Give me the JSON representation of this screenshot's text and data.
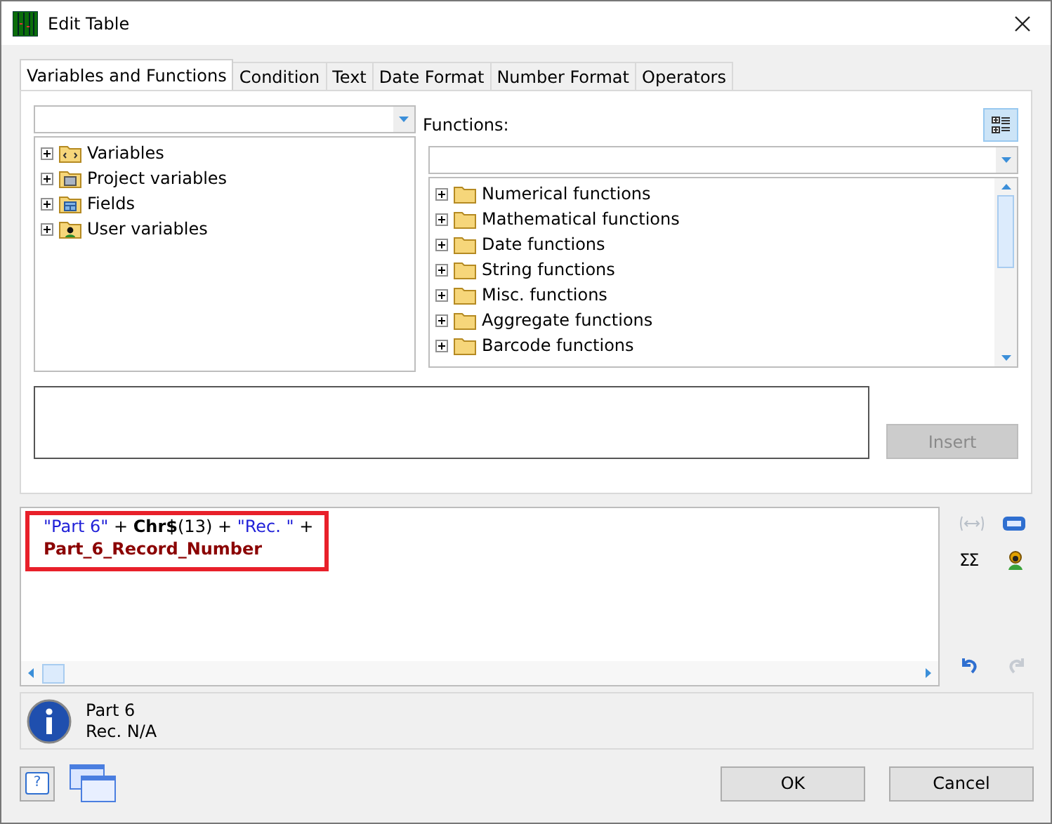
{
  "window": {
    "title": "Edit Table"
  },
  "tabs": [
    {
      "label": "Variables and Functions",
      "selected": true
    },
    {
      "label": "Condition",
      "selected": false
    },
    {
      "label": "Text",
      "selected": false
    },
    {
      "label": "Date Format",
      "selected": false
    },
    {
      "label": "Number Format",
      "selected": false
    },
    {
      "label": "Operators",
      "selected": false
    }
  ],
  "variables_tree": {
    "items": [
      {
        "label": "Variables",
        "kind": "variables",
        "expanded": false
      },
      {
        "label": "Project variables",
        "kind": "project",
        "expanded": false
      },
      {
        "label": "Fields",
        "kind": "fields",
        "expanded": false
      },
      {
        "label": "User variables",
        "kind": "user",
        "expanded": false
      }
    ]
  },
  "functions": {
    "label": "Functions:",
    "items": [
      {
        "label": "Numerical functions",
        "expanded": false
      },
      {
        "label": "Mathematical functions",
        "expanded": false
      },
      {
        "label": "Date functions",
        "expanded": false
      },
      {
        "label": "String functions",
        "expanded": false
      },
      {
        "label": "Misc. functions",
        "expanded": false
      },
      {
        "label": "Aggregate functions",
        "expanded": false
      },
      {
        "label": "Barcode functions",
        "expanded": false
      }
    ]
  },
  "insert_button": {
    "label": "Insert",
    "disabled": true
  },
  "expression": {
    "highlighted": true,
    "lines": [
      [
        {
          "text": "\"Part 6\"",
          "kind": "string"
        },
        {
          "text": " + ",
          "kind": "plain"
        },
        {
          "text": "Chr$",
          "kind": "function"
        },
        {
          "text": "(13) + ",
          "kind": "plain"
        },
        {
          "text": "\"Rec. \"",
          "kind": "string"
        },
        {
          "text": " +",
          "kind": "plain"
        }
      ],
      [
        {
          "text": "Part_6_Record_Number",
          "kind": "field"
        }
      ]
    ]
  },
  "tool_icons": {
    "sum": "ΣΣ"
  },
  "help_button": {
    "label": "?"
  },
  "info": {
    "lines": [
      "Part 6",
      "Rec. N/A"
    ]
  },
  "buttons": [
    {
      "label": "OK"
    },
    {
      "label": "Cancel"
    }
  ]
}
